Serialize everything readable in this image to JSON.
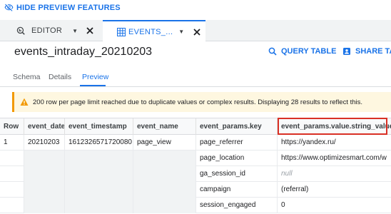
{
  "top": {
    "hide_preview": "HIDE PREVIEW FEATURES"
  },
  "tabs": [
    {
      "label": "EDITOR"
    },
    {
      "label": "EVENTS_..."
    }
  ],
  "title": "events_intraday_20210203",
  "actions": {
    "query": "QUERY TABLE",
    "share": "SHARE TABLE"
  },
  "subtabs": [
    {
      "label": "Schema"
    },
    {
      "label": "Details"
    },
    {
      "label": "Preview"
    }
  ],
  "warning": "200 row per page limit reached due to duplicate values or complex results. Displaying 28 results to reflect this.",
  "table": {
    "headers": [
      "Row",
      "event_date",
      "event_timestamp",
      "event_name",
      "event_params.key",
      "event_params.value.string_value"
    ],
    "row1": {
      "row": "1",
      "date": "20210203",
      "ts": "1612326571720080",
      "name": "page_view"
    },
    "params": [
      {
        "key": "page_referrer",
        "value": "https://yandex.ru/"
      },
      {
        "key": "page_location",
        "value": "https://www.optimizesmart.com/w"
      },
      {
        "key": "ga_session_id",
        "value": "null"
      },
      {
        "key": "campaign",
        "value": "(referral)"
      },
      {
        "key": "session_engaged",
        "value": "0"
      }
    ]
  },
  "colors": {
    "accent": "#1a73e8",
    "warning_bg": "#fef7e0",
    "highlight": "#d93025"
  }
}
